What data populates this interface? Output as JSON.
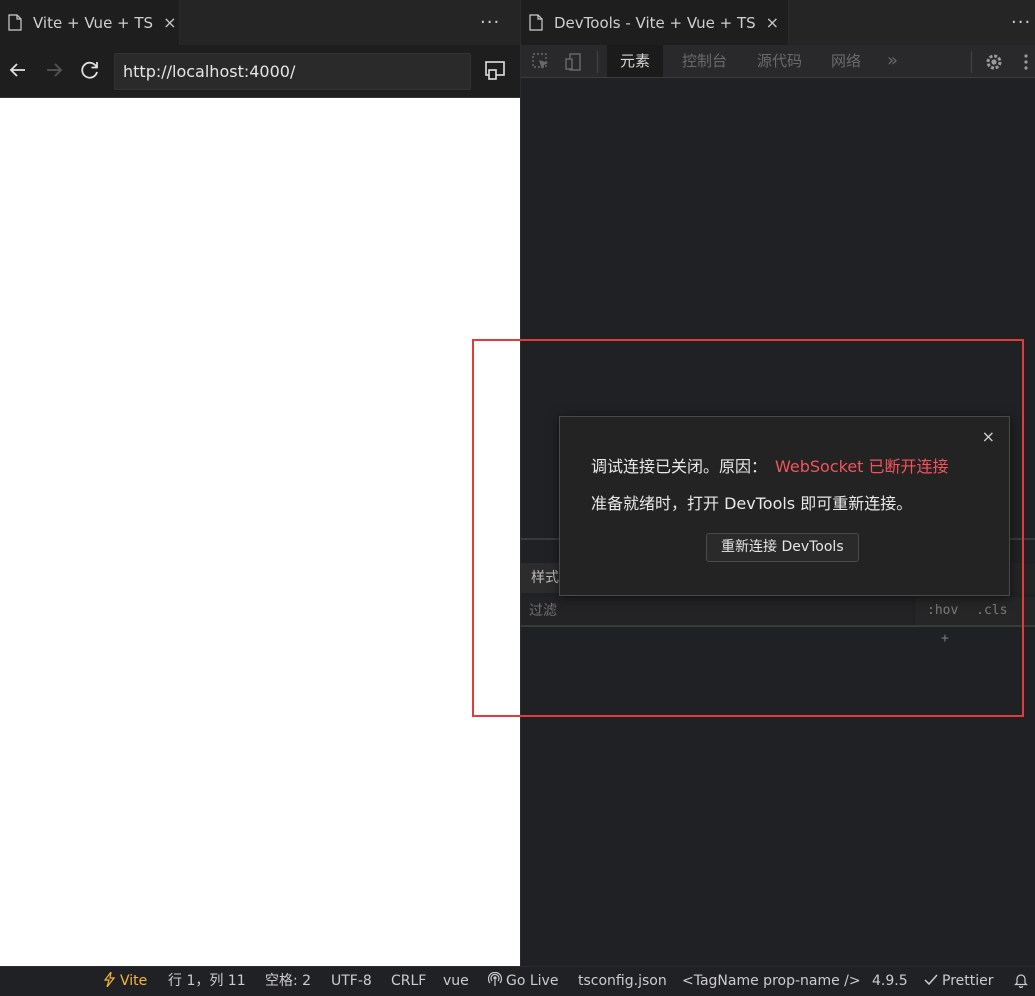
{
  "browser": {
    "tab_title": "Vite + Vue + TS",
    "url": "http://localhost:4000/"
  },
  "devtools": {
    "tab_title": "DevTools - Vite + Vue + TS",
    "panels": [
      "元素",
      "控制台",
      "源代码",
      "网络"
    ],
    "more_panels": "»",
    "styles_tab": "样式",
    "filter_placeholder": "过滤",
    "hov_label": ":hov",
    "cls_label": ".cls",
    "add_label": "+"
  },
  "dialog": {
    "message_prefix": "调试连接已关闭。原因：",
    "reason": "WebSocket 已断开连接",
    "message_line2": "准备就绪时，打开 DevTools 即可重新连接。",
    "button_label": "重新连接 DevTools",
    "close_symbol": "×"
  },
  "statusbar": {
    "vite": "Vite",
    "position": "行 1，列 11",
    "spaces": "空格: 2",
    "encoding": "UTF-8",
    "eol": "CRLF",
    "language": "vue",
    "go_live": "Go Live",
    "tsconfig": "tsconfig.json",
    "tag_name": "<TagName prop-name />",
    "version": "4.9.5",
    "prettier": "Prettier"
  },
  "colors": {
    "accent_error": "#f2545b",
    "highlight": "#e23b3b",
    "vite": "#f6b73c"
  },
  "icons": {
    "file": "file-icon",
    "close": "close-icon",
    "more": "more-icon",
    "back": "back-arrow-icon",
    "forward": "forward-arrow-icon",
    "reload": "reload-icon",
    "screencast": "screencast-icon",
    "inspect": "inspect-element-icon",
    "device": "device-toggle-icon",
    "gear": "gear-icon",
    "kebab": "kebab-menu-icon",
    "bolt": "bolt-icon",
    "broadcast": "broadcast-icon",
    "check": "check-icon",
    "bell": "bell-icon"
  }
}
